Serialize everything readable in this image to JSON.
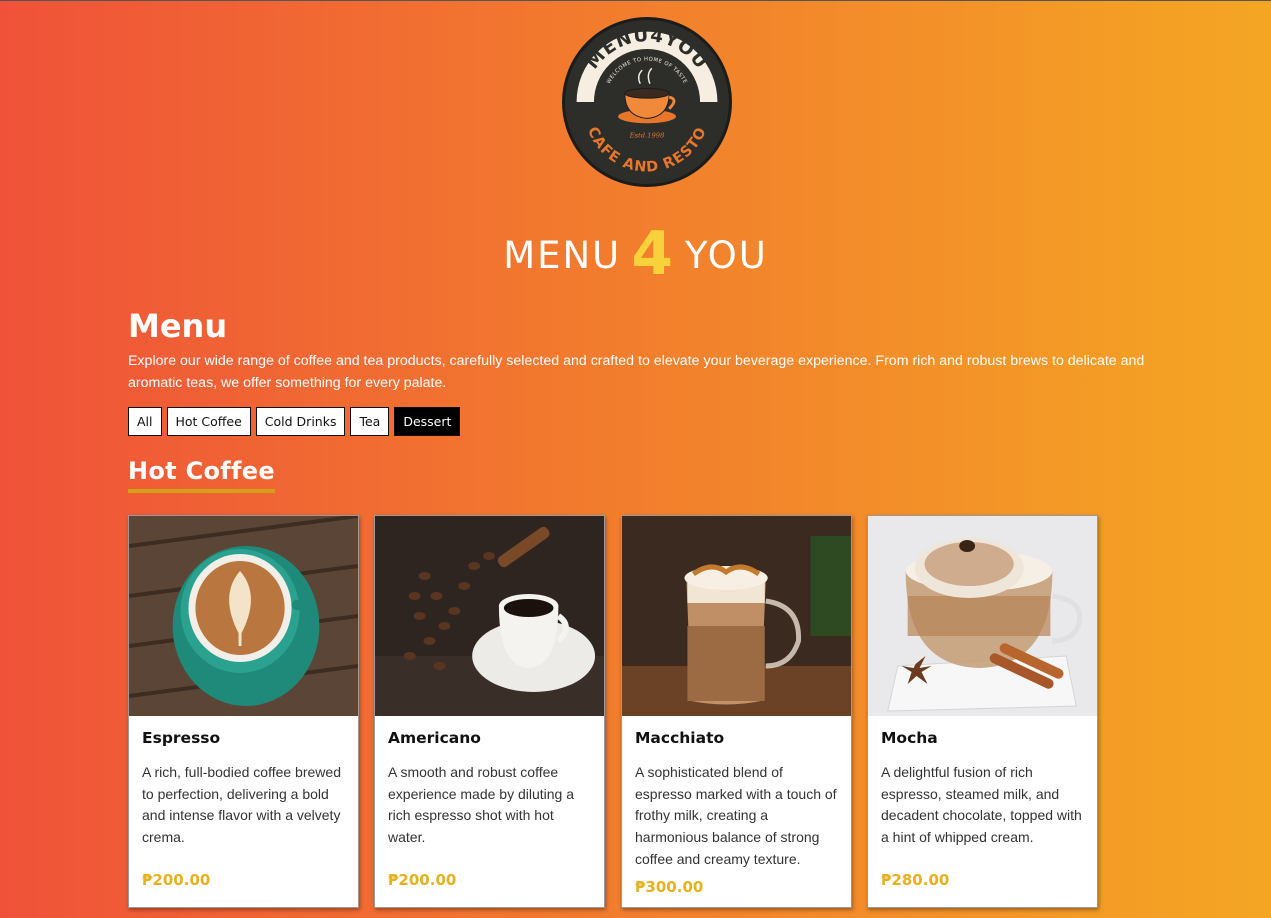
{
  "logo": {
    "top_text": "MENU4YOU",
    "tagline": "WELCOME TO HOME OF TASTE",
    "estd": "Estd.1998",
    "bottom_text": "CAFE AND RESTO"
  },
  "brand": {
    "left": "MENU",
    "number": "4",
    "right": "YOU"
  },
  "menu": {
    "title": "Menu",
    "description": "Explore our wide range of coffee and tea products, carefully selected and crafted to elevate your beverage experience. From rich and robust brews to delicate and aromatic teas, we offer something for every palate."
  },
  "filters": [
    {
      "label": "All",
      "active": false
    },
    {
      "label": "Hot Coffee",
      "active": false
    },
    {
      "label": "Cold Drinks",
      "active": false
    },
    {
      "label": "Tea",
      "active": false
    },
    {
      "label": "Dessert",
      "active": true
    }
  ],
  "section": {
    "title": "Hot Coffee"
  },
  "products": [
    {
      "name": "Espresso",
      "description": "A rich, full-bodied coffee brewed to perfection, delivering a bold and intense flavor with a velvety crema.",
      "price": "₱200.00",
      "image": "espresso-latte-art-photo"
    },
    {
      "name": "Americano",
      "description": "A smooth and robust coffee experience made by diluting a rich espresso shot with hot water.",
      "price": "₱200.00",
      "image": "americano-coffee-beans-photo"
    },
    {
      "name": "Macchiato",
      "description": "A sophisticated blend of espresso marked with a touch of frothy milk, creating a harmonious balance of strong coffee and creamy texture.",
      "price": "₱300.00",
      "image": "macchiato-glass-photo"
    },
    {
      "name": "Mocha",
      "description": "A delightful fusion of rich espresso, steamed milk, and decadent chocolate, topped with a hint of whipped cream.",
      "price": "₱280.00",
      "image": "mocha-cinnamon-photo"
    }
  ],
  "colors": {
    "bg_left": "#ef5239",
    "bg_right": "#f4a623",
    "accent": "#f8d23a",
    "price": "#e5b21e",
    "underline": "#d4a017"
  }
}
